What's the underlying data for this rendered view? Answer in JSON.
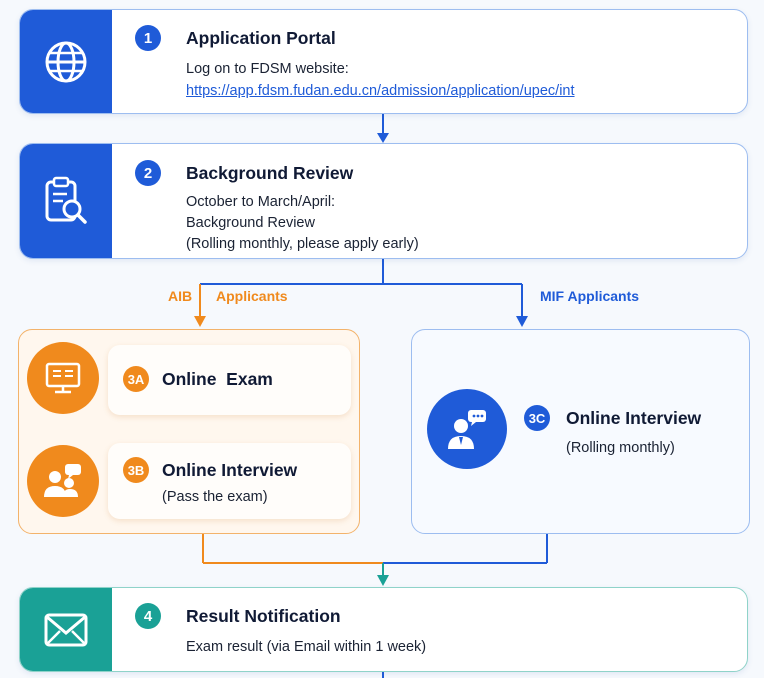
{
  "steps": {
    "s1": {
      "number": "1",
      "title": "Application Portal",
      "line1": "Log on to FDSM website:",
      "link": "https://app.fdsm.fudan.edu.cn/admission/application/upec/int",
      "icon": "globe-icon"
    },
    "s2": {
      "number": "2",
      "title": "Background Review",
      "line1": "October to March/April:",
      "line2": "Background Review",
      "line3": "(Rolling monthly, please apply early)",
      "icon": "clipboard-search-icon"
    },
    "s3a": {
      "number": "3A",
      "title": "Online  Exam",
      "icon": "monitor-exam-icon"
    },
    "s3b": {
      "number": "3B",
      "title": "Online Interview",
      "line1": "(Pass the exam)",
      "icon": "people-chat-icon"
    },
    "s3c": {
      "number": "3C",
      "title": "Online Interview",
      "line1": "(Rolling monthly)",
      "icon": "person-chat-icon"
    },
    "s4": {
      "number": "4",
      "title": "Result Notification",
      "line1": "Exam result (via Email within 1 week)",
      "icon": "envelope-icon"
    }
  },
  "branches": {
    "aib_prefix": "AIB",
    "aib_label": "Applicants",
    "mif_label": "MIF Applicants"
  },
  "colors": {
    "blue": "#1f5bd8",
    "orange": "#f08a1d",
    "teal": "#1aa196"
  }
}
